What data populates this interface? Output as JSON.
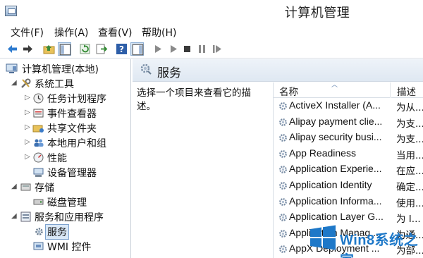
{
  "window": {
    "title": "计算机管理"
  },
  "menu": [
    "文件(F)",
    "操作(A)",
    "查看(V)",
    "帮助(H)"
  ],
  "toolbar": {
    "buttons": [
      "back-arrow-icon",
      "forward-arrow-icon",
      "up-folder-icon",
      "show-tree-icon",
      "refresh-icon",
      "export-list-icon",
      "help-icon",
      "show-action-pane-icon",
      "play-icon",
      "play-alt-icon",
      "stop-icon",
      "pause-icon",
      "restart-icon"
    ]
  },
  "tree": {
    "root": "计算机管理(本地)",
    "items": [
      {
        "label": "系统工具",
        "icon": "tools-icon"
      },
      {
        "label": "任务计划程序",
        "icon": "clock-icon"
      },
      {
        "label": "事件查看器",
        "icon": "event-viewer-icon"
      },
      {
        "label": "共享文件夹",
        "icon": "shared-folder-icon"
      },
      {
        "label": "本地用户和组",
        "icon": "users-icon"
      },
      {
        "label": "性能",
        "icon": "performance-icon"
      },
      {
        "label": "设备管理器",
        "icon": "device-manager-icon"
      },
      {
        "label": "存储",
        "icon": "storage-icon"
      },
      {
        "label": "磁盘管理",
        "icon": "disk-icon"
      },
      {
        "label": "服务和应用程序",
        "icon": "services-apps-icon"
      },
      {
        "label": "服务",
        "icon": "services-icon"
      },
      {
        "label": "WMI 控件",
        "icon": "wmi-icon"
      }
    ]
  },
  "services_panel": {
    "title": "服务",
    "description": "选择一个项目来查看它的描述。",
    "columns": {
      "name": "名称",
      "description": "描述"
    },
    "rows": [
      {
        "name": "ActiveX Installer (A...",
        "desc": "为从..."
      },
      {
        "name": "Alipay payment clie...",
        "desc": "为支..."
      },
      {
        "name": "Alipay security busi...",
        "desc": "为支..."
      },
      {
        "name": "App Readiness",
        "desc": "当用..."
      },
      {
        "name": "Application Experie...",
        "desc": "在应..."
      },
      {
        "name": "Application Identity",
        "desc": "确定..."
      },
      {
        "name": "Application Informa...",
        "desc": "使用..."
      },
      {
        "name": "Application Layer G...",
        "desc": "为 I..."
      },
      {
        "name": "Application Manag...",
        "desc": "为通..."
      },
      {
        "name": "AppX Deployment ...",
        "desc": "为部..."
      }
    ]
  },
  "watermark": {
    "text": "Win8系统之家"
  },
  "colors": {
    "accent": "#1e78c8",
    "header_bg": "#e4ecf5",
    "selection": "#d9e8f7"
  }
}
